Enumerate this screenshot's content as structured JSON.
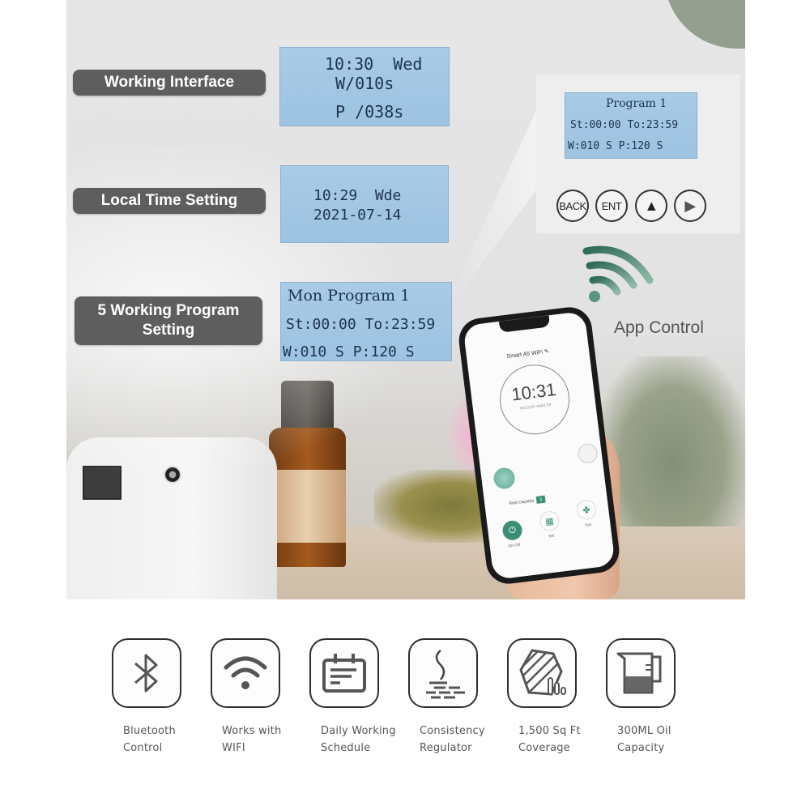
{
  "labels": {
    "working_interface": "Working Interface",
    "local_time_setting": "Local Time Setting",
    "program_setting_line1": "5 Working Program",
    "program_setting_line2": "Setting",
    "app_control": "App Control"
  },
  "lcd_working": {
    "line1": "10:30  Wed",
    "line2": "W/010s",
    "line3": "P /038s"
  },
  "lcd_time": {
    "line1": "10:29  Wde",
    "line2": "2021-07-14"
  },
  "lcd_program": {
    "line1": "Mon Program 1",
    "line2": "St:00:00 To:23:59",
    "line3": "W:010 S P:120 S"
  },
  "panel": {
    "lcd_line1": "Program 1",
    "lcd_line2": "St:00:00 To:23:59",
    "lcd_line3": "W:010 S P:120 S",
    "buttons": {
      "back": "BACK",
      "ent": "ENT",
      "up": "▲",
      "next": "▶"
    }
  },
  "phone_app": {
    "title": "Smart A5 WiFi ✎",
    "clock_time": "10:31",
    "clock_subtitle": "Wd12:00~Wd11:59",
    "capacity_label": "Rest Capacity",
    "capacity_value": "5",
    "actions": [
      {
        "label": "On/ Off",
        "icon": "power-icon"
      },
      {
        "label": "Set",
        "icon": "settings-grid-icon"
      },
      {
        "label": "Fan",
        "icon": "fan-icon"
      }
    ]
  },
  "features": [
    {
      "icon": "bluetooth-icon",
      "line1": "Bluetooth",
      "line2": "Control"
    },
    {
      "icon": "wifi-icon",
      "line1": "Works with",
      "line2": "WIFI"
    },
    {
      "icon": "calendar-icon",
      "line1": "Daily Working",
      "line2": "Schedule"
    },
    {
      "icon": "steam-regulator-icon",
      "line1": "Consistency",
      "line2": "Regulator"
    },
    {
      "icon": "coverage-area-icon",
      "line1": "1,500 Sq Ft",
      "line2": "Coverage"
    },
    {
      "icon": "measuring-cup-icon",
      "line1": "300ML Oil",
      "line2": "Capacity"
    }
  ],
  "colors": {
    "lcd_background": "#a3c8e4",
    "lcd_text": "#1c3350",
    "label_pill": "#5e5e5e",
    "app_accent": "#3c8f77",
    "icon_stroke": "#2e2e2e"
  }
}
